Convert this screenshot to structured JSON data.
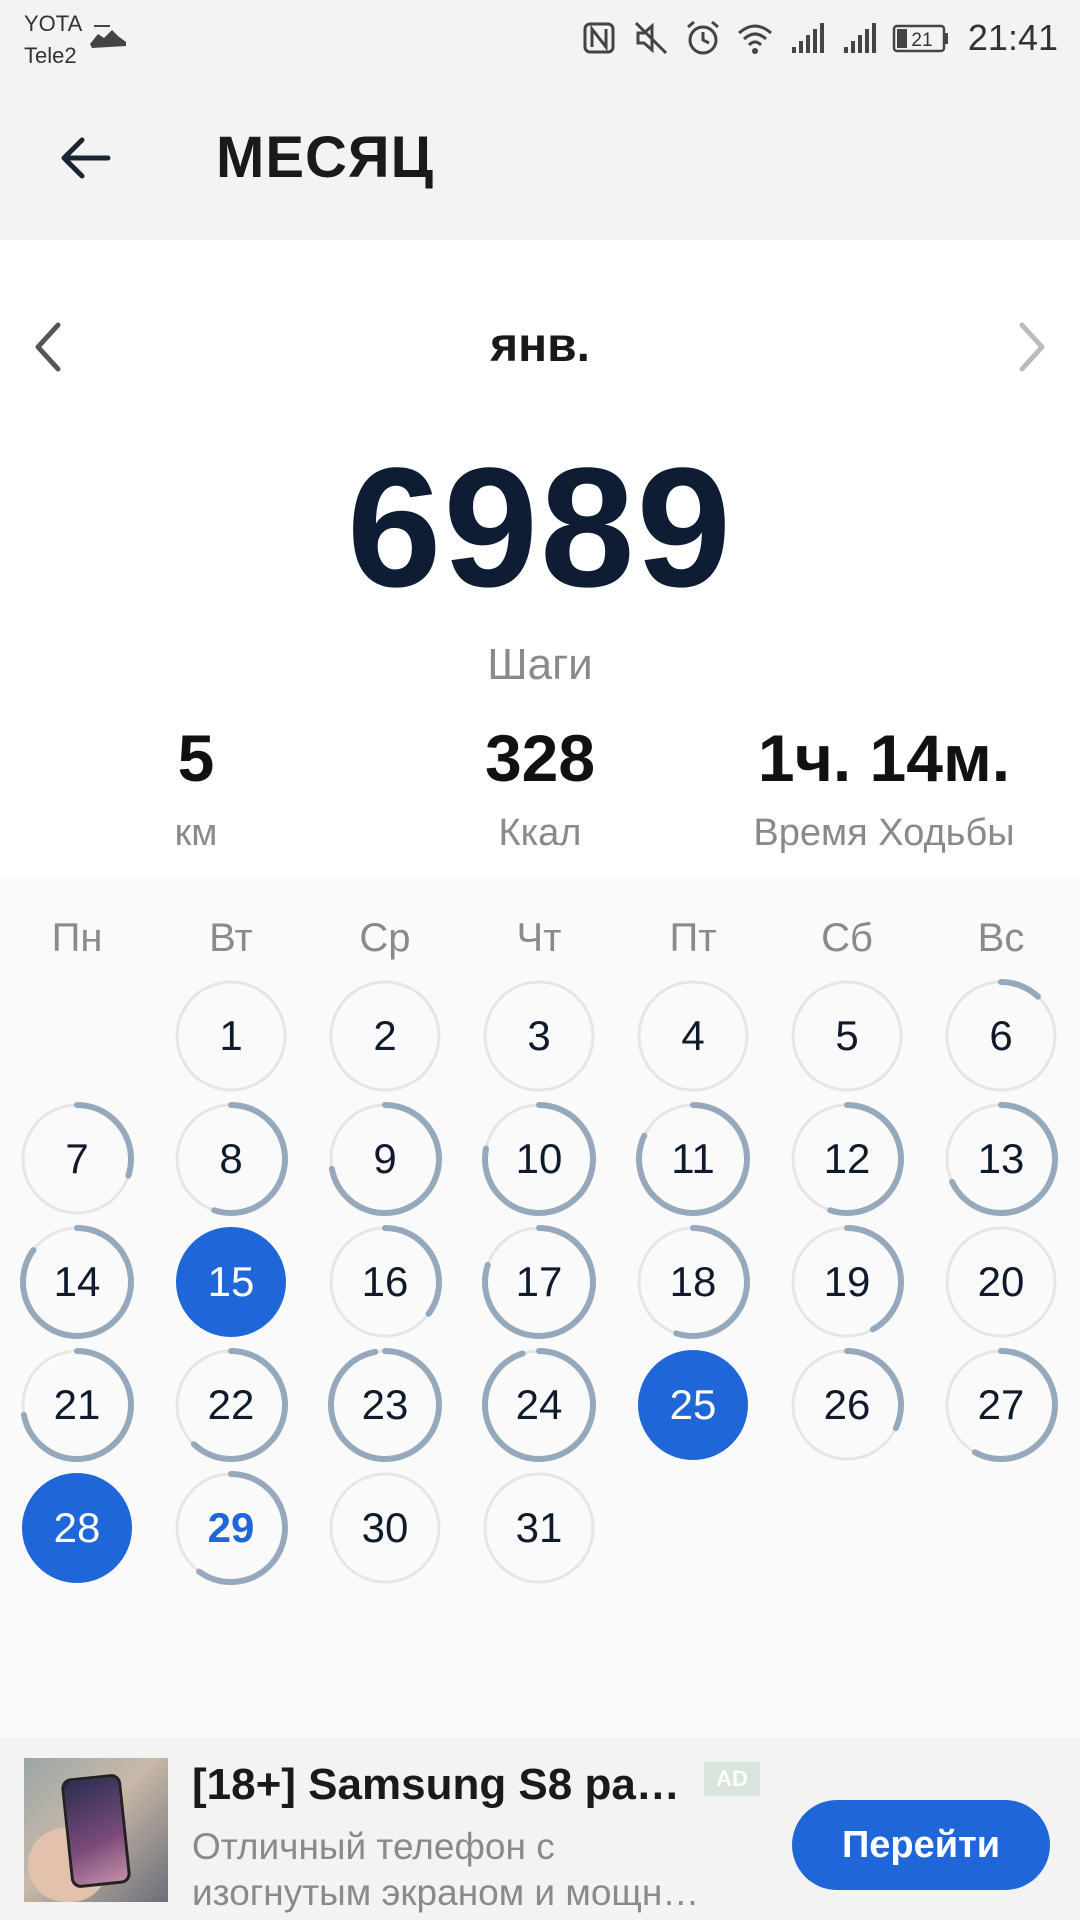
{
  "status_bar": {
    "carrier_1": "YOTA",
    "carrier_2": "Tele2",
    "time": "21:41",
    "battery": "21",
    "icons": [
      "shoe-icon",
      "nfc-icon",
      "mute-icon",
      "alarm-icon",
      "wifi-icon",
      "signal-icon",
      "signal-icon",
      "battery-icon"
    ]
  },
  "header": {
    "title": "МЕСЯЦ",
    "back_icon": "arrow-left-icon"
  },
  "month_nav": {
    "month": "янв.",
    "prev_icon": "chevron-left-icon",
    "next_icon": "chevron-right-icon"
  },
  "summary": {
    "steps": "6989",
    "steps_label": "Шаги",
    "distance": "5",
    "distance_label": "км",
    "calories": "328",
    "calories_label": "Ккал",
    "walk_time": "1ч. 14м.",
    "walk_time_label": "Время Ходьбы"
  },
  "calendar": {
    "weekdays": [
      "Пн",
      "Вт",
      "Ср",
      "Чт",
      "Пт",
      "Сб",
      "Вс"
    ],
    "first_weekday_index": 1,
    "days": [
      {
        "day": "1",
        "progress": 0,
        "state": "normal"
      },
      {
        "day": "2",
        "progress": 0,
        "state": "normal"
      },
      {
        "day": "3",
        "progress": 0,
        "state": "normal"
      },
      {
        "day": "4",
        "progress": 0,
        "state": "normal"
      },
      {
        "day": "5",
        "progress": 0,
        "state": "normal"
      },
      {
        "day": "6",
        "progress": 0.12,
        "state": "normal"
      },
      {
        "day": "7",
        "progress": 0.3,
        "state": "normal"
      },
      {
        "day": "8",
        "progress": 0.55,
        "state": "normal"
      },
      {
        "day": "9",
        "progress": 0.72,
        "state": "normal"
      },
      {
        "day": "10",
        "progress": 0.78,
        "state": "normal"
      },
      {
        "day": "11",
        "progress": 0.82,
        "state": "normal"
      },
      {
        "day": "12",
        "progress": 0.55,
        "state": "normal"
      },
      {
        "day": "13",
        "progress": 0.68,
        "state": "normal"
      },
      {
        "day": "14",
        "progress": 0.85,
        "state": "normal"
      },
      {
        "day": "15",
        "progress": 1,
        "state": "selected"
      },
      {
        "day": "16",
        "progress": 0.35,
        "state": "normal"
      },
      {
        "day": "17",
        "progress": 0.8,
        "state": "normal"
      },
      {
        "day": "18",
        "progress": 0.55,
        "state": "normal"
      },
      {
        "day": "19",
        "progress": 0.42,
        "state": "normal"
      },
      {
        "day": "20",
        "progress": 0,
        "state": "normal"
      },
      {
        "day": "21",
        "progress": 0.72,
        "state": "normal"
      },
      {
        "day": "22",
        "progress": 0.62,
        "state": "normal"
      },
      {
        "day": "23",
        "progress": 0.97,
        "state": "normal"
      },
      {
        "day": "24",
        "progress": 0.95,
        "state": "normal"
      },
      {
        "day": "25",
        "progress": 1,
        "state": "selected"
      },
      {
        "day": "26",
        "progress": 0.32,
        "state": "normal"
      },
      {
        "day": "27",
        "progress": 0.58,
        "state": "normal"
      },
      {
        "day": "28",
        "progress": 1,
        "state": "selected"
      },
      {
        "day": "29",
        "progress": 0.6,
        "state": "today"
      },
      {
        "day": "30",
        "progress": 0,
        "state": "normal"
      },
      {
        "day": "31",
        "progress": 0,
        "state": "normal"
      }
    ]
  },
  "ad": {
    "title": "[18+] Samsung S8 ра…",
    "badge": "AD",
    "description_line_1": "Отличный телефон с",
    "description_line_2": "изогнутым экраном и мощн…",
    "cta": "Перейти"
  },
  "colors": {
    "accent": "#1f66d9",
    "ring_progress": "#96a8bc",
    "ring_track": "#e6e6e6",
    "big_number": "#0e1d33",
    "secondary_text": "#8a8a8a",
    "header_bg": "#f3f3f3"
  }
}
